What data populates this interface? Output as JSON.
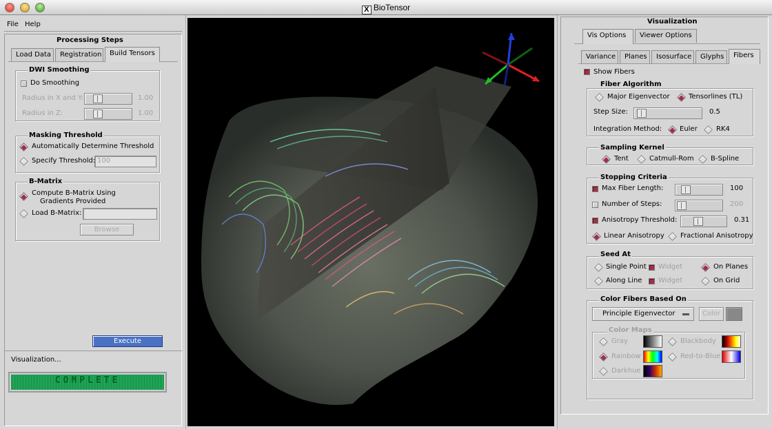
{
  "window": {
    "title": "BioTensor",
    "x_glyph": "X"
  },
  "menu": {
    "file": "File",
    "help": "Help"
  },
  "left": {
    "header": "Processing Steps",
    "tabs": [
      "Load Data",
      "Registration",
      "Build Tensors"
    ],
    "dwi": {
      "title": "DWI Smoothing",
      "do_smoothing": "Do Smoothing",
      "radius_xy": "Radius in X and Y:",
      "radius_xy_val": "1.00",
      "radius_z": "Radius in Z:",
      "radius_z_val": "1.00"
    },
    "mask": {
      "title": "Masking Threshold",
      "auto": "Automatically Determine Threshold",
      "specify": "Specify Threshold:",
      "specify_val": "100"
    },
    "bmatrix": {
      "title": "B-Matrix",
      "compute_line1": "Compute B-Matrix Using",
      "compute_line2": "Gradients Provided",
      "load": "Load B-Matrix:",
      "browse": "Browse"
    },
    "execute": "Execute",
    "status_label": "Visualization...",
    "progress_text": "COMPLETE",
    "progress": 1.0
  },
  "right": {
    "header": "Visualization",
    "tabs1": [
      "Vis Options",
      "Viewer Options"
    ],
    "tabs2": [
      "Variance",
      "Planes",
      "Isosurface",
      "Glyphs",
      "Fibers"
    ],
    "show_fibers": "Show Fibers",
    "alg": {
      "title": "Fiber Algorithm",
      "major": "Major Eigenvector",
      "tensorlines": "Tensorlines (TL)",
      "step_size": "Step Size:",
      "step_val": "0.5",
      "integration": "Integration Method:",
      "euler": "Euler",
      "rk4": "RK4"
    },
    "kernel": {
      "title": "Sampling Kernel",
      "tent": "Tent",
      "catmull": "Catmull-Rom",
      "bspline": "B-Spline"
    },
    "stop": {
      "title": "Stopping Criteria",
      "max_len": "Max Fiber Length:",
      "max_len_val": "100",
      "num_steps": "Number of Steps:",
      "num_steps_val": "200",
      "aniso": "Anisotropy Threshold:",
      "aniso_val": "0.31",
      "linear": "Linear Anisotropy",
      "fractional": "Fractional Anisotropy"
    },
    "seed": {
      "title": "Seed At",
      "single": "Single Point",
      "widget1": "Widget",
      "planes": "On Planes",
      "line": "Along Line",
      "widget2": "Widget",
      "grid": "On Grid"
    },
    "color": {
      "title": "Color Fibers Based On",
      "option": "Principle Eigenvector",
      "color_btn": "Color",
      "maps_title": "Color Maps",
      "gray": "Gray",
      "rainbow": "Rainbow",
      "darkhue": "Darkhue",
      "blackbody": "Blackbody",
      "red_to_blue": "Red-to-Blue"
    },
    "colors": {
      "accent": "#a0304a",
      "progress": "#1a9a50",
      "execute": "#4a72c4"
    }
  }
}
